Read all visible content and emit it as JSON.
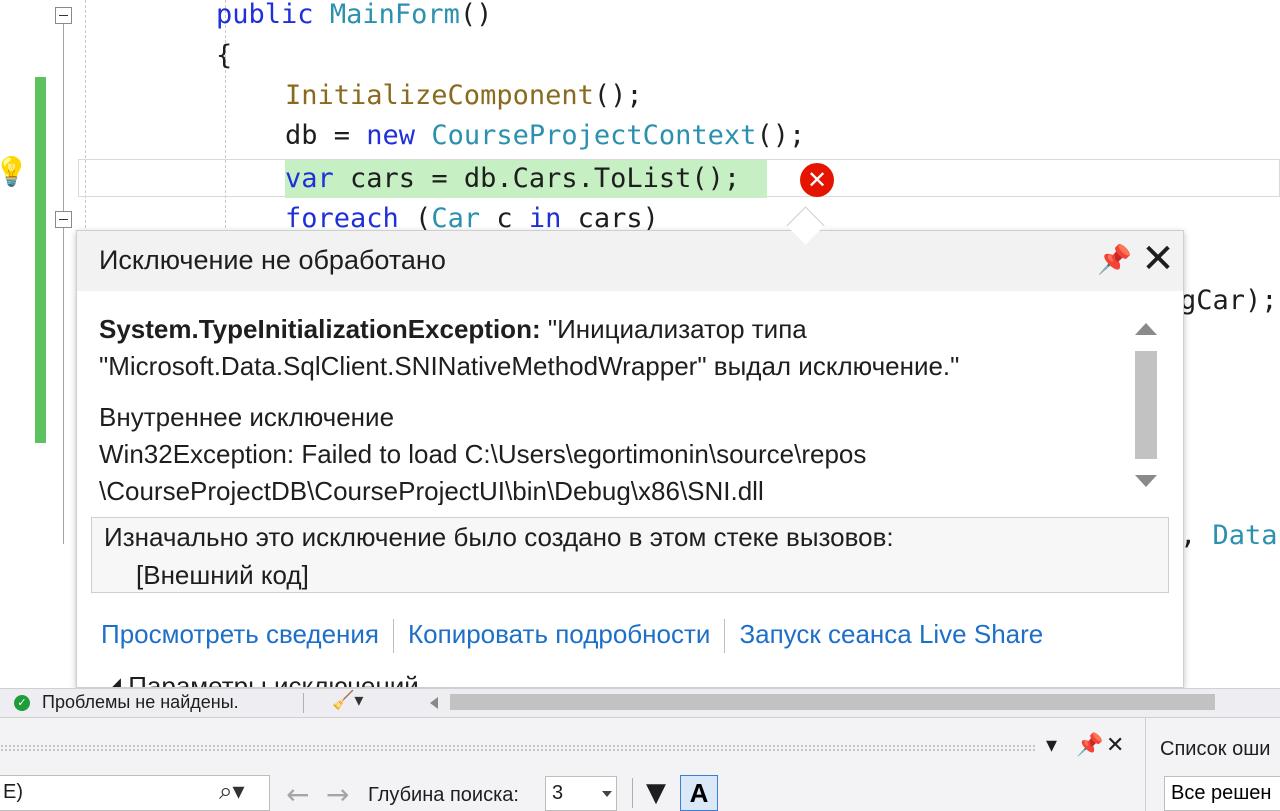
{
  "editor": {
    "lines": {
      "l1_kw": "public",
      "l1_name": "MainForm",
      "l1_rest": "()",
      "l2": "{",
      "l3_call": "InitializeComponent",
      "l3_rest": "();",
      "l4_a": "db = ",
      "l4_kw": "new",
      "l4_type": "CourseProjectContext",
      "l4_rest": "();",
      "l5_kw": "var",
      "l5_rest": " cars = db.Cars.ToList();",
      "l6_kw": "foreach",
      "l6_a": " (",
      "l6_type": "Car",
      "l6_b": " c ",
      "l6_kw2": "in",
      "l6_c": " cars)",
      "right_frag1": "gCar);",
      "right_frag2_sep": ",",
      "right_frag2_type": "Data"
    }
  },
  "popup": {
    "title": "Исключение не обработано",
    "exception_type": "System.TypeInitializationException:",
    "exception_message": " \"Инициализатор типа \"Microsoft.Data.SqlClient.SNINativeMethodWrapper\" выдал исключение.\"",
    "inner_label": "Внутреннее исключение",
    "inner_message": "Win32Exception: Failed to load C:\\Users\\egortimonin\\source\\repos \\CourseProjectDB\\CourseProjectUI\\bin\\Debug\\x86\\SNI.dll",
    "stack_title": "Изначально это исключение было создано в этом стеке вызовов:",
    "stack_item": "[Внешний код]",
    "links": {
      "view_details": "Просмотреть сведения",
      "copy_details": "Копировать подробности",
      "live_share": "Запуск сеанса Live Share"
    },
    "params_label": "◢ Параметры исключений"
  },
  "status_bar": {
    "issues_text": "Проблемы не найдены."
  },
  "bottom_panel": {
    "search_value": "E)",
    "depth_label": "Глубина поиска:",
    "depth_value": "3",
    "case_button": "A",
    "error_list_title": "Список оши",
    "error_list_scope": "Все решен"
  },
  "colors": {
    "keyword": "#1f30d8",
    "type": "#2b91af",
    "link": "#1e6fc8",
    "error": "#e51400",
    "change_bar": "#5cc25f"
  }
}
